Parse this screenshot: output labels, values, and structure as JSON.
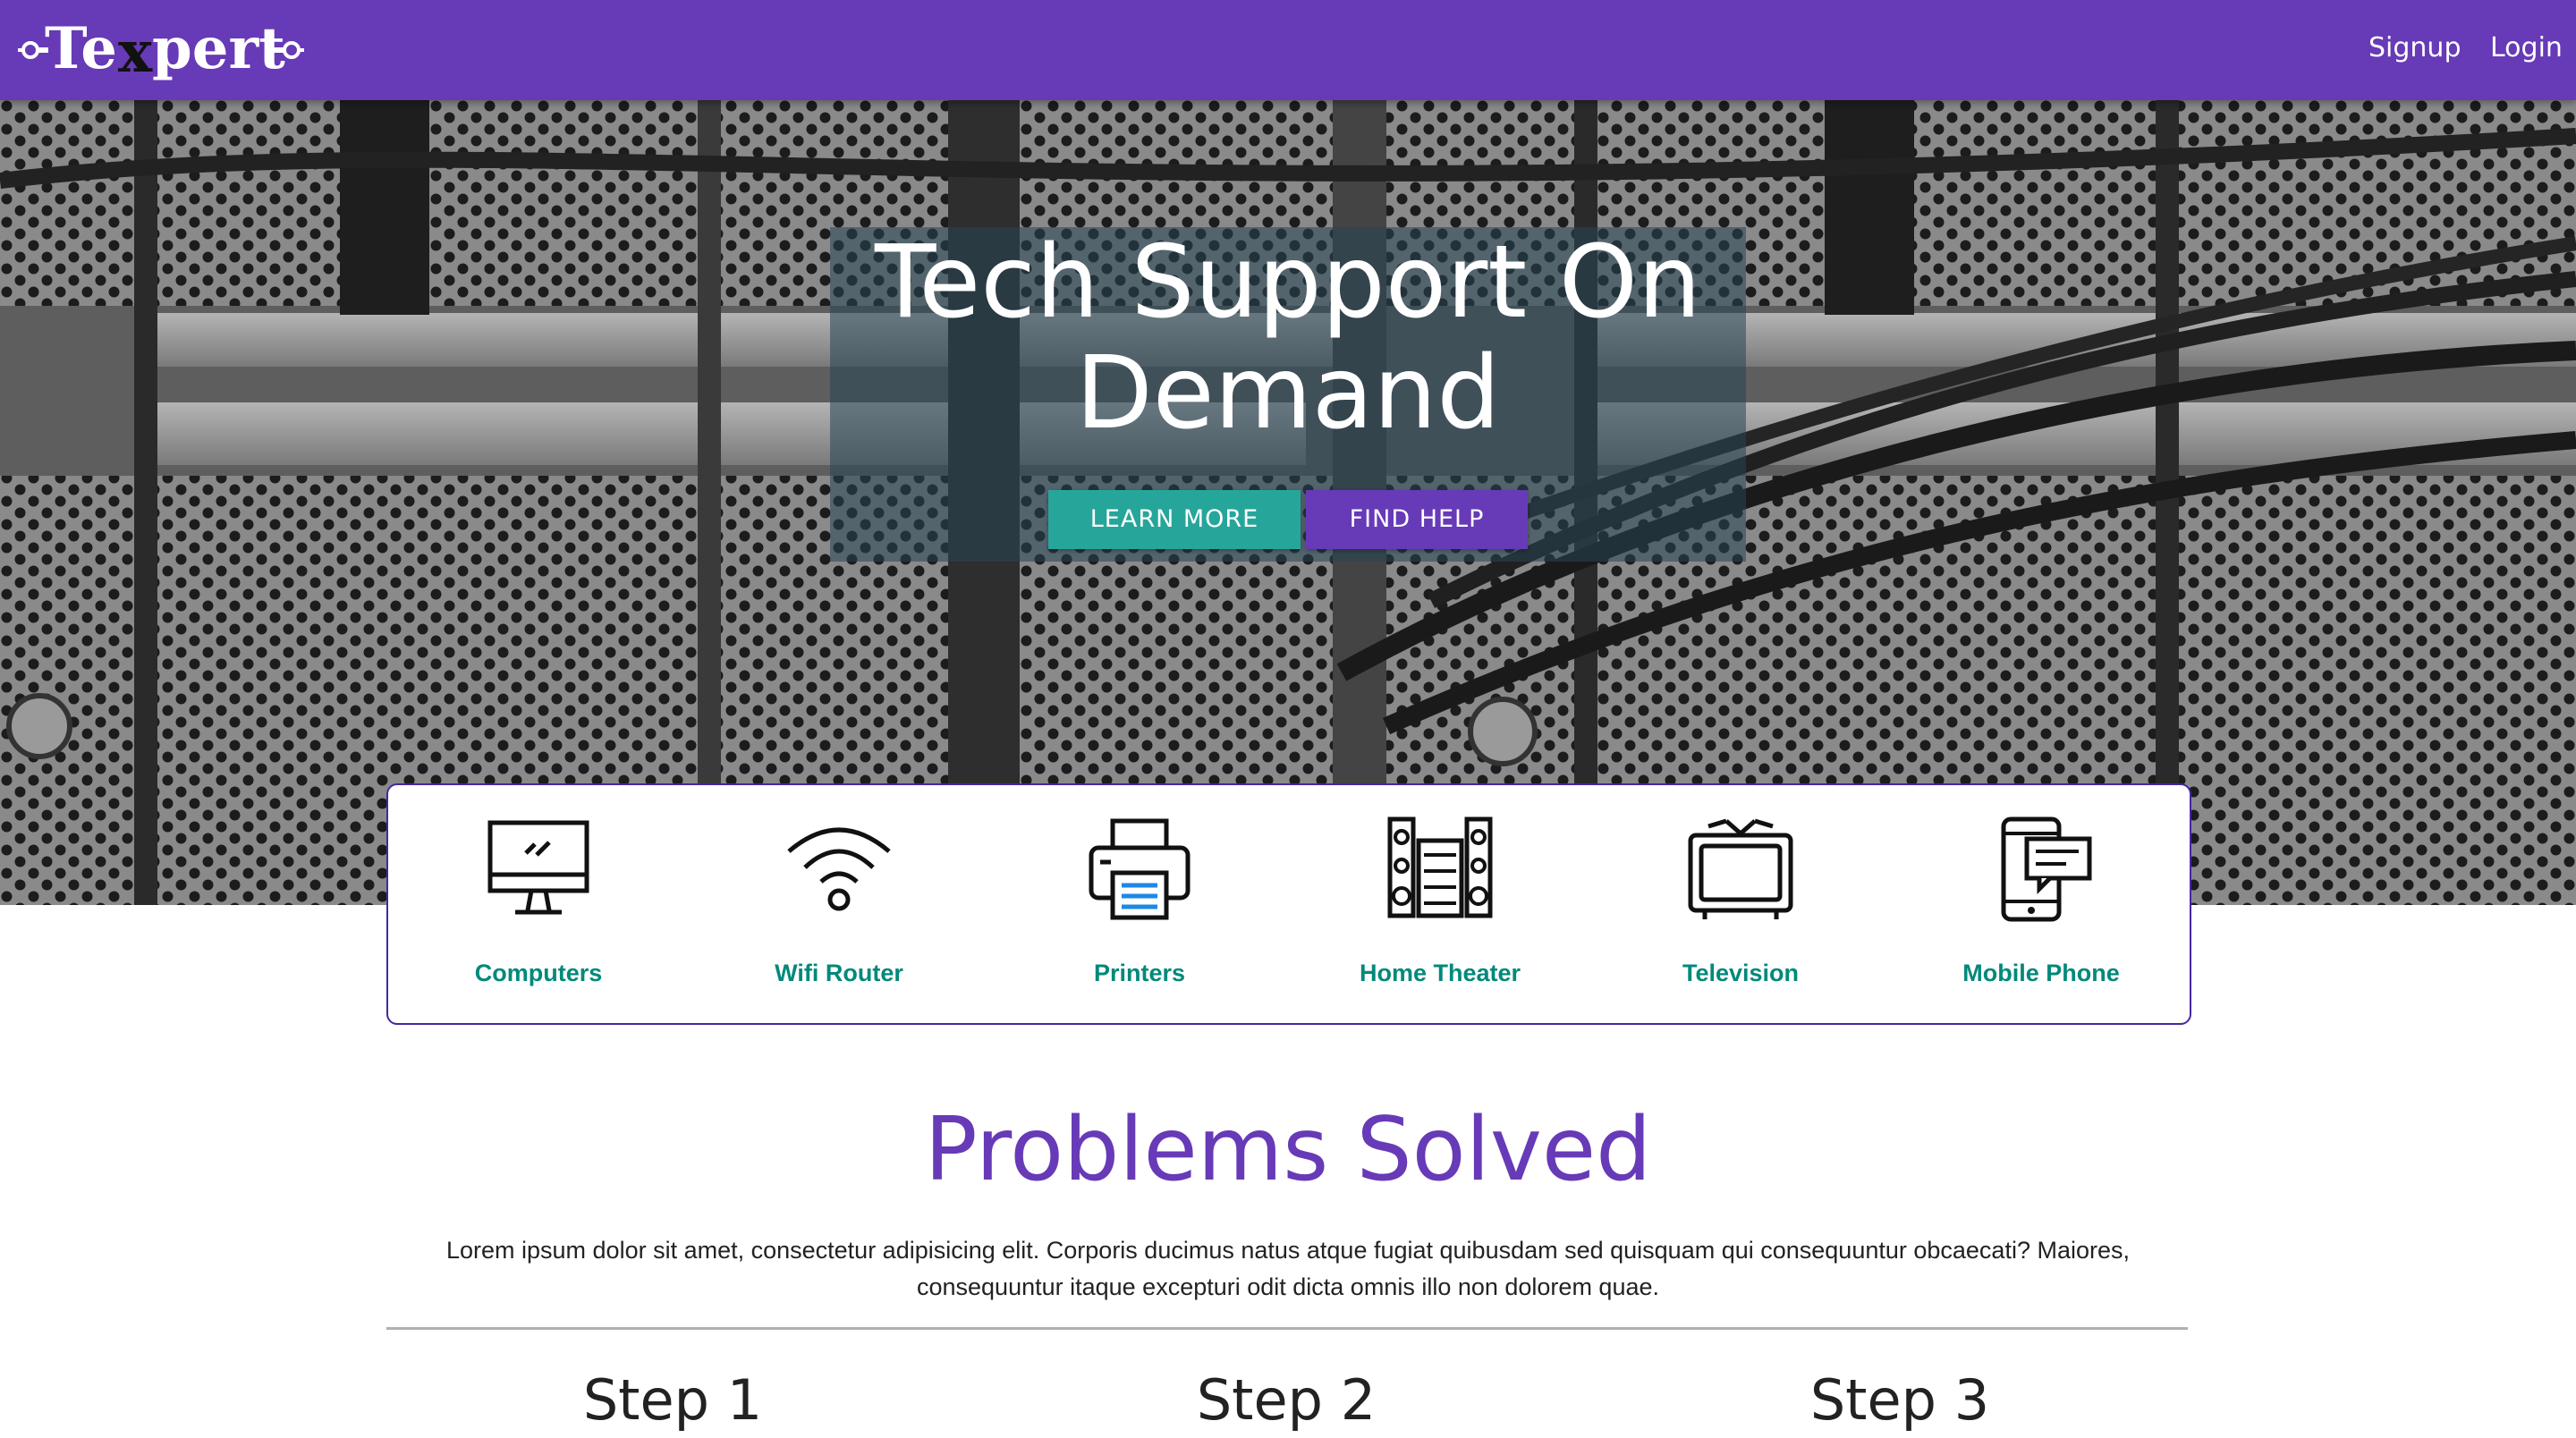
{
  "navbar": {
    "brand": "Texpert",
    "links": {
      "signup": "Signup",
      "login": "Login"
    }
  },
  "hero": {
    "title": "Tech Support On Demand",
    "buttons": {
      "learn_more": "Learn More",
      "find_help": "Find Help"
    }
  },
  "categories": [
    {
      "label": "Computers",
      "icon": "computer-icon"
    },
    {
      "label": "Wifi Router",
      "icon": "wifi-icon"
    },
    {
      "label": "Printers",
      "icon": "printer-icon"
    },
    {
      "label": "Home Theater",
      "icon": "home-theater-icon"
    },
    {
      "label": "Television",
      "icon": "television-icon"
    },
    {
      "label": "Mobile Phone",
      "icon": "mobile-phone-icon"
    }
  ],
  "problems": {
    "title": "Problems Solved",
    "text": "Lorem ipsum dolor sit amet, consectetur adipisicing elit. Corporis ducimus natus atque fugiat quibusdam sed quisquam qui consequuntur obcaecati? Maiores, consequuntur itaque excepturi odit dicta omnis illo non dolorem quae.",
    "steps": [
      "Step 1",
      "Step 2",
      "Step 3"
    ]
  },
  "colors": {
    "primary": "#673ab7",
    "accent": "#26a69a",
    "category_text": "#00897b",
    "card_border": "#4527a0"
  }
}
